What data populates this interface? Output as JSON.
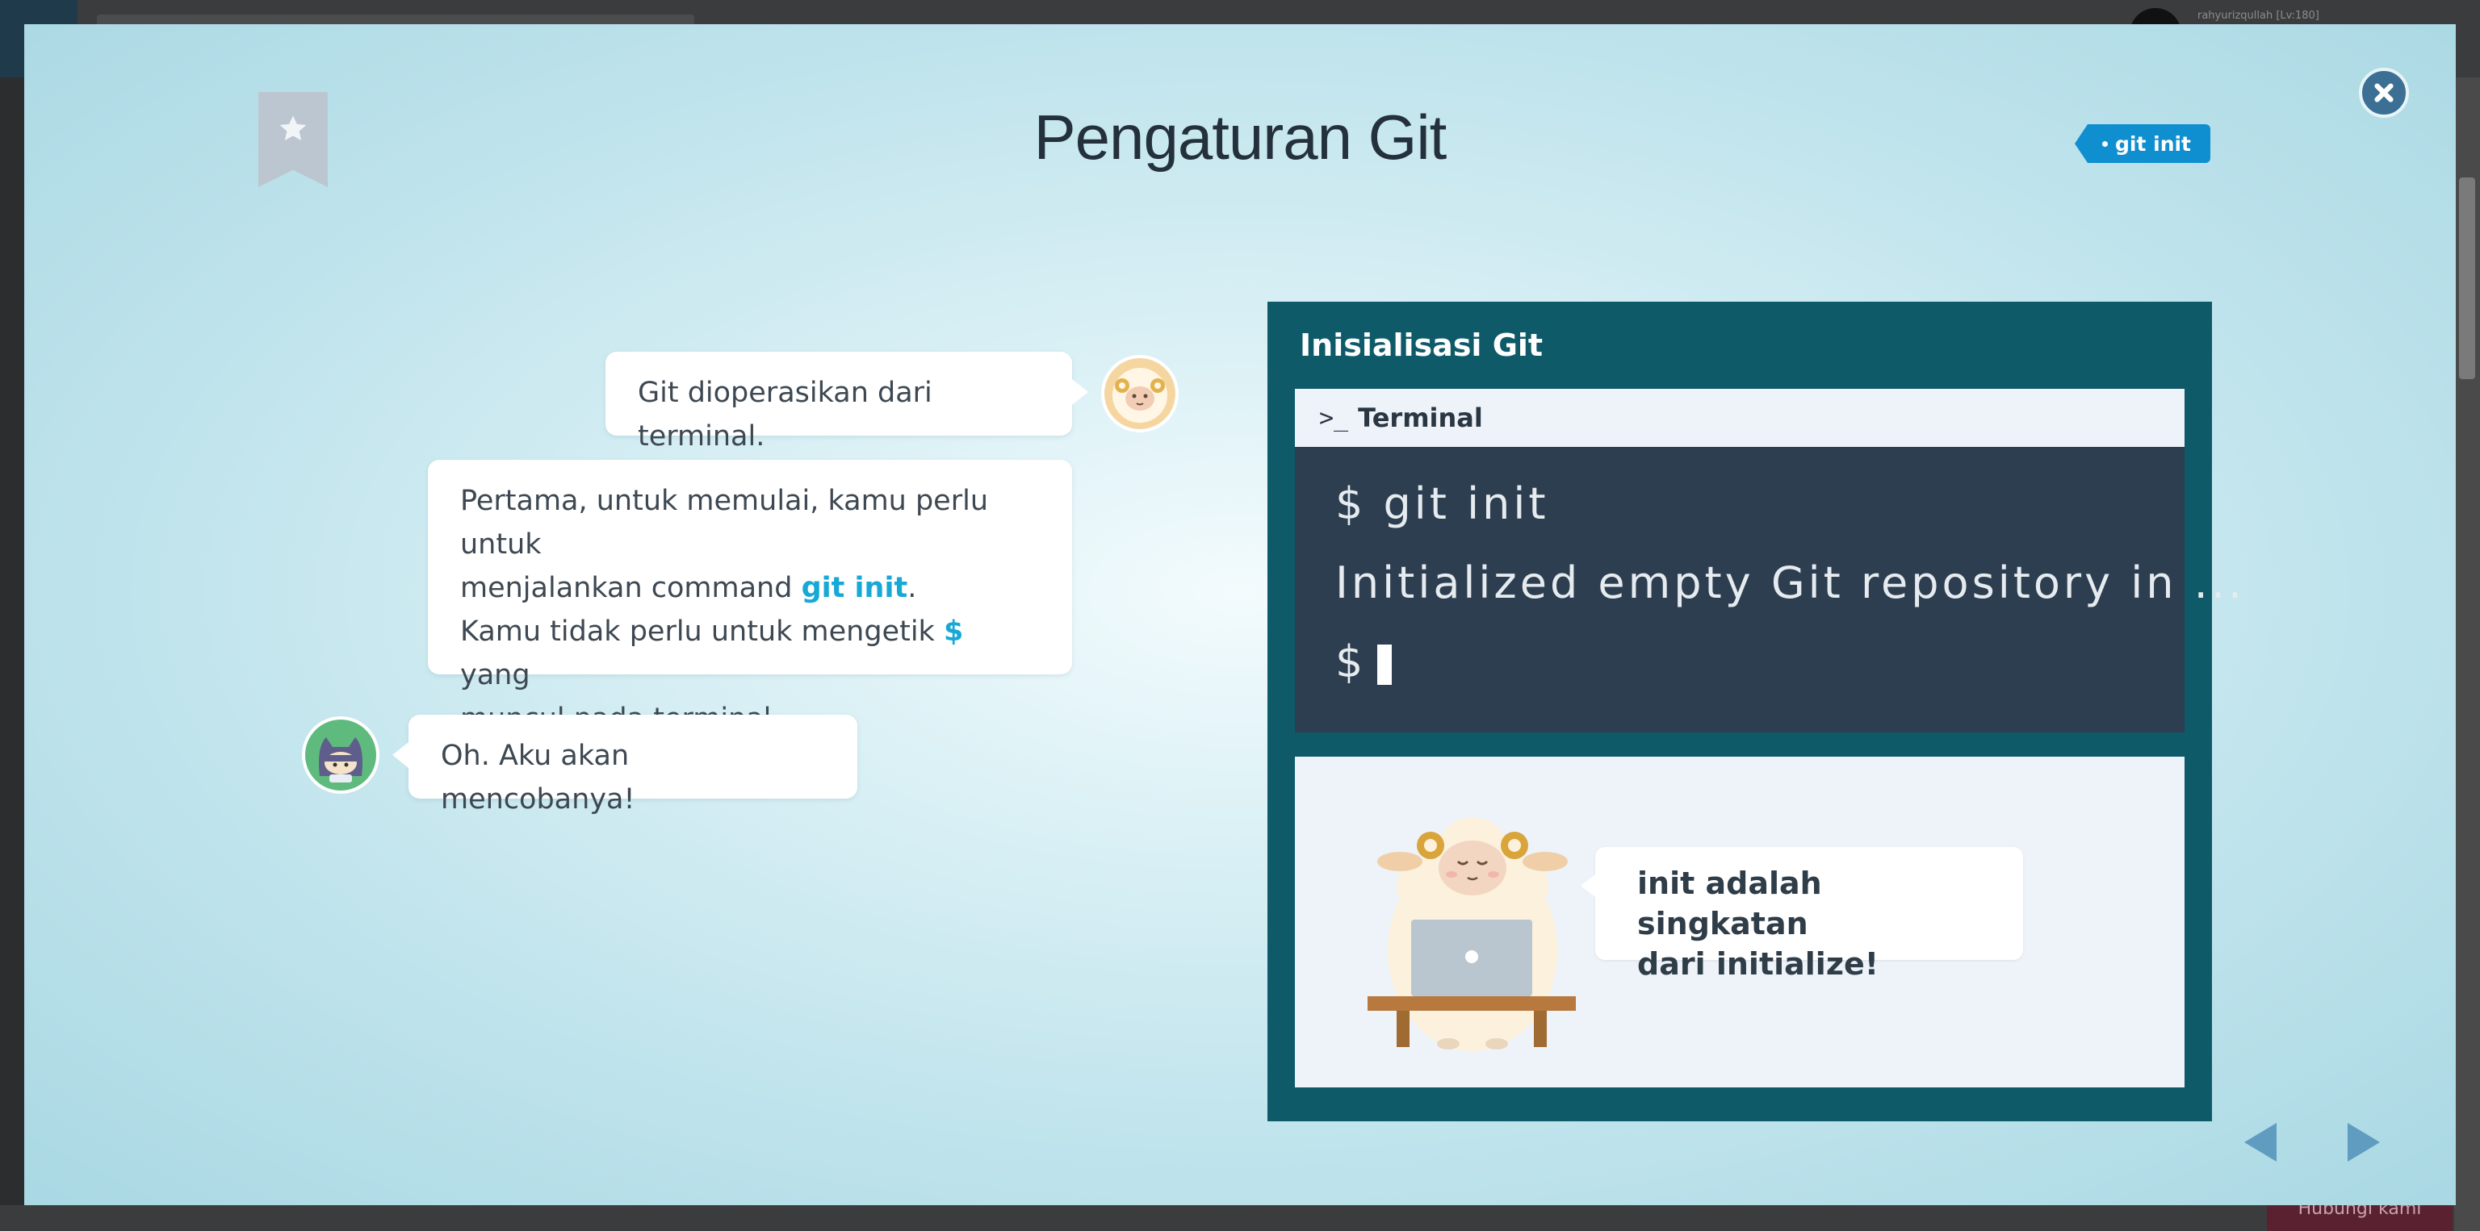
{
  "background_app": {
    "user_label": "rahyurizqullah [Lv:180]",
    "bottom_action": "Hubungi kami"
  },
  "modal": {
    "title": "Pengaturan Git",
    "tag": "git init",
    "icons": {
      "bookmark": "bookmark-star-icon",
      "close": "close-icon",
      "prev": "arrow-left-icon",
      "next": "arrow-right-icon"
    }
  },
  "chat": {
    "bubble1": "Git dioperasikan dari terminal.",
    "bubble2": {
      "line1_prefix": "Pertama, untuk memulai, kamu perlu untuk",
      "line2_prefix": "menjalankan command ",
      "command": "git init",
      "line2_suffix": ".",
      "line3_prefix": "Kamu tidak perlu untuk mengetik ",
      "dollar": "$",
      "line3_suffix": " yang",
      "line4": "muncul pada terminal."
    },
    "bubble3": "Oh. Aku akan mencobanya!"
  },
  "panel": {
    "title": "Inisialisasi Git",
    "terminal": {
      "header": "Terminal",
      "lines": [
        "$ git init",
        "Initialized empty Git repository in ...",
        "$"
      ]
    },
    "speech": {
      "line1": "init adalah singkatan",
      "line2": "dari initialize!"
    }
  },
  "colors": {
    "accent": "#17a9d6",
    "panel": "#0e5a69",
    "terminal_bg": "#2c3e50",
    "tag": "#0f8fd0"
  }
}
